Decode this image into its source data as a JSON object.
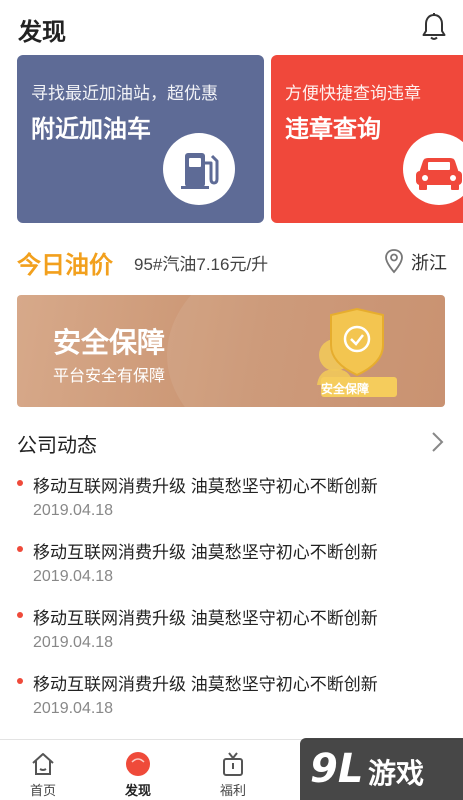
{
  "header": {
    "title": "发现",
    "bell_icon": "bell-icon"
  },
  "cards": [
    {
      "subtitle": "寻找最近加油站，超优惠",
      "title": "附近加油车",
      "icon": "gas-pump-icon",
      "color": "#5e6b96"
    },
    {
      "subtitle": "方便快捷查询违章",
      "title": "违章查询",
      "icon": "car-icon",
      "color": "#f0483b"
    }
  ],
  "oil": {
    "label": "今日油价",
    "price": "95#汽油7.16元/升",
    "location": "浙江",
    "location_icon": "location-pin-icon",
    "accent": "#f2a01d"
  },
  "banner": {
    "title": "安全保障",
    "subtitle": "平台安全有保障",
    "badge_text": "安全保障",
    "icon": "shield-check-icon"
  },
  "news": {
    "title": "公司动态",
    "more_icon": "chevron-right-icon",
    "items": [
      {
        "headline": "移动互联网消费升级 油莫愁坚守初心不断创新",
        "date": "2019.04.18"
      },
      {
        "headline": "移动互联网消费升级 油莫愁坚守初心不断创新",
        "date": "2019.04.18"
      },
      {
        "headline": "移动互联网消费升级 油莫愁坚守初心不断创新",
        "date": "2019.04.18"
      },
      {
        "headline": "移动互联网消费升级 油莫愁坚守初心不断创新",
        "date": "2019.04.18"
      }
    ]
  },
  "tabbar": {
    "tabs": [
      {
        "label": "首页",
        "icon": "home-icon",
        "active": false
      },
      {
        "label": "发现",
        "icon": "discover-icon",
        "active": true
      },
      {
        "label": "福利",
        "icon": "gift-icon",
        "active": false
      }
    ]
  },
  "watermark": {
    "mark": "9L",
    "text": "游戏"
  }
}
